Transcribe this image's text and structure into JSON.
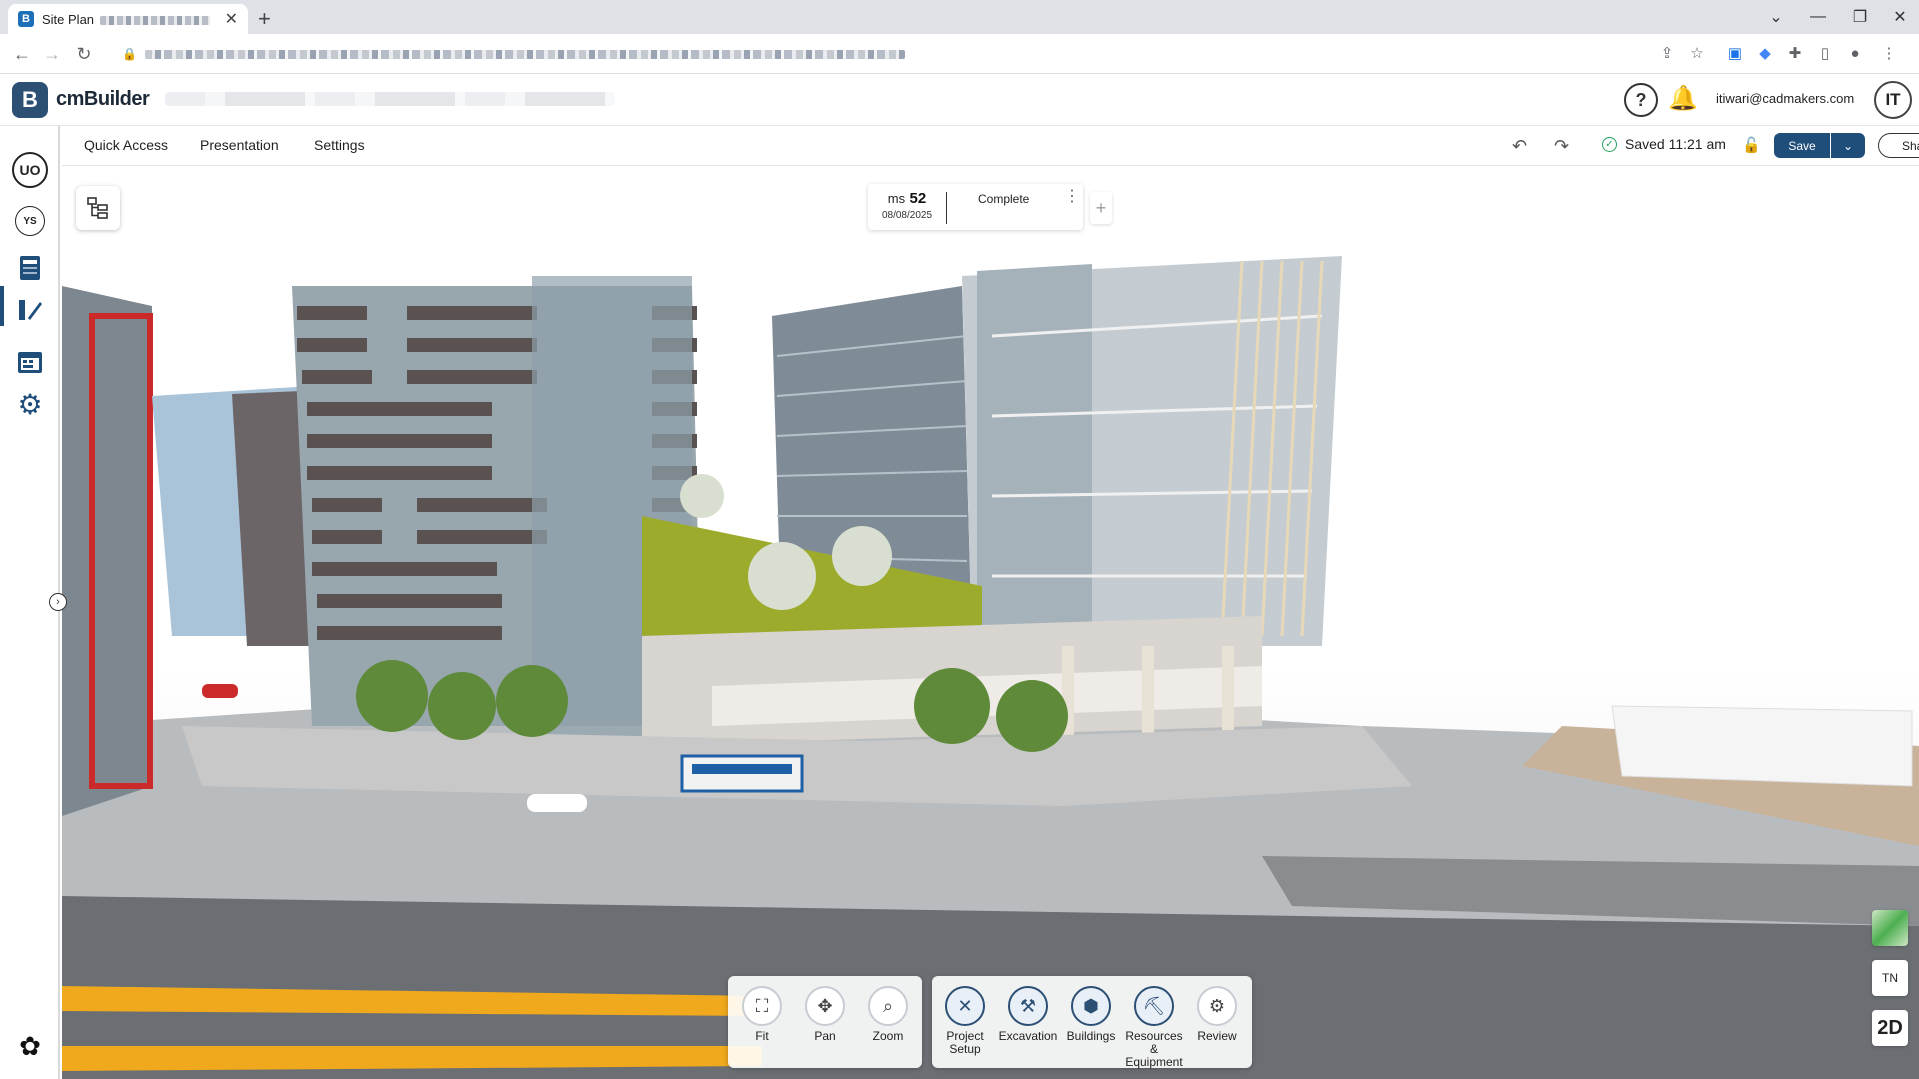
{
  "browser": {
    "tab_title": "Site Plan",
    "tab_close": "✕",
    "new_tab": "+",
    "window_controls": [
      "⌄",
      "—",
      "❐",
      "✕"
    ]
  },
  "app": {
    "logo_letter": "B",
    "logo_text": "cmBuilder",
    "help": "?",
    "user_email": "itiwari@cadmakers.com",
    "avatar_initials": "IT"
  },
  "menu": {
    "items": [
      "Quick Access",
      "Presentation",
      "Settings"
    ],
    "saved_text": "Saved 11:21 am",
    "save_label": "Save",
    "share_label": "Share"
  },
  "sidebar": {
    "items": [
      {
        "label": "UO",
        "icon": "uo-icon"
      },
      {
        "label": "YS",
        "icon": "ys-icon"
      },
      {
        "label": "",
        "icon": "schedule-icon"
      },
      {
        "label": "",
        "icon": "site-plan-icon"
      },
      {
        "label": "",
        "icon": "calendar-icon"
      },
      {
        "label": "",
        "icon": "gear-icon"
      }
    ]
  },
  "milestone": {
    "prefix": "ms",
    "number": "52",
    "date": "08/08/2025",
    "status": "Complete"
  },
  "toolbar": {
    "view_tools": [
      {
        "label": "Fit",
        "icon": "fit-icon"
      },
      {
        "label": "Pan",
        "icon": "pan-icon"
      },
      {
        "label": "Zoom",
        "icon": "zoom-icon"
      }
    ],
    "phase_tools": [
      {
        "label": "Project Setup",
        "icon": "project-setup-icon"
      },
      {
        "label": "Excavation",
        "icon": "excavation-icon"
      },
      {
        "label": "Buildings",
        "icon": "buildings-icon"
      },
      {
        "label": "Resources & Equipment",
        "icon": "resources-icon"
      },
      {
        "label": "Review",
        "icon": "review-icon"
      }
    ]
  },
  "right_controls": {
    "compass": "TN",
    "view_mode": "2D"
  },
  "colors": {
    "brand": "#1f4e7a",
    "saved_ok": "#27a35d"
  }
}
